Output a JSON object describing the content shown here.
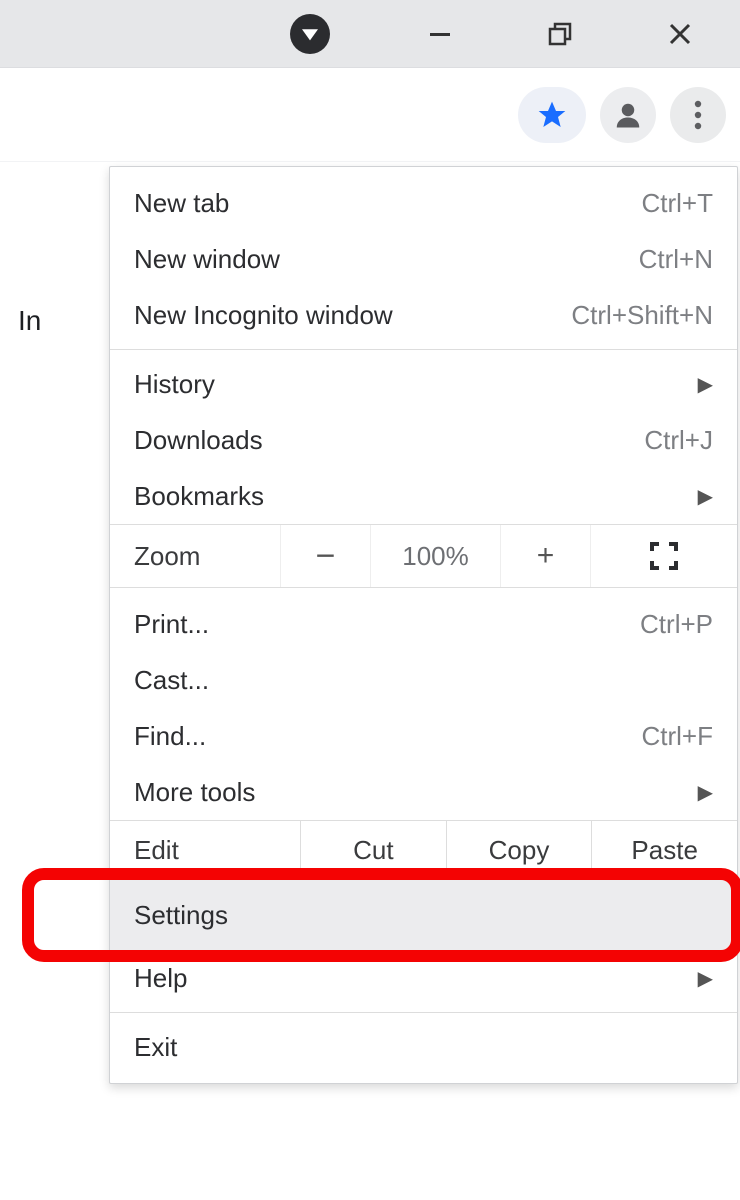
{
  "bg_text_fragment": "In",
  "menu": {
    "new_tab": {
      "label": "New tab",
      "shortcut": "Ctrl+T"
    },
    "new_window": {
      "label": "New window",
      "shortcut": "Ctrl+N"
    },
    "new_incognito": {
      "label": "New Incognito window",
      "shortcut": "Ctrl+Shift+N"
    },
    "history": {
      "label": "History"
    },
    "downloads": {
      "label": "Downloads",
      "shortcut": "Ctrl+J"
    },
    "bookmarks": {
      "label": "Bookmarks"
    },
    "zoom": {
      "label": "Zoom",
      "minus": "−",
      "pct": "100%",
      "plus": "+"
    },
    "print": {
      "label": "Print...",
      "shortcut": "Ctrl+P"
    },
    "cast": {
      "label": "Cast..."
    },
    "find": {
      "label": "Find...",
      "shortcut": "Ctrl+F"
    },
    "more_tools": {
      "label": "More tools"
    },
    "edit": {
      "label": "Edit",
      "cut": "Cut",
      "copy": "Copy",
      "paste": "Paste"
    },
    "settings": {
      "label": "Settings"
    },
    "help": {
      "label": "Help"
    },
    "exit": {
      "label": "Exit"
    }
  }
}
